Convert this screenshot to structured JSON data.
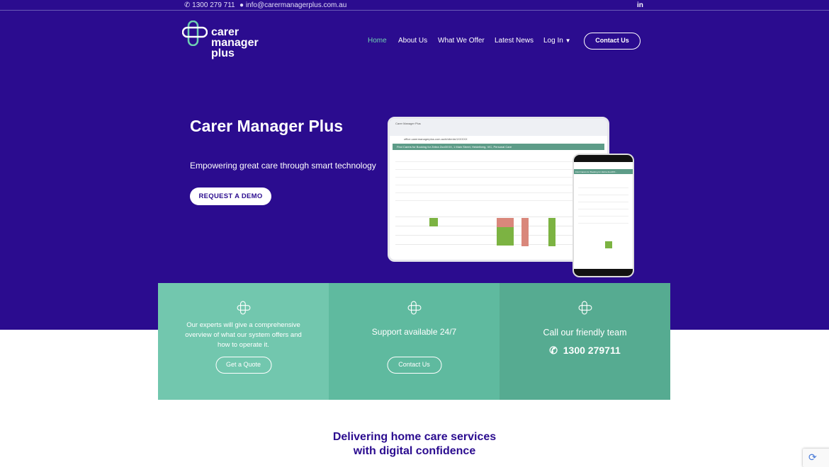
{
  "topbar": {
    "phone": "1300 279 711",
    "email": "info@carermanagerplus.com.au",
    "social": "linkedin-icon"
  },
  "logo": {
    "line1": "carer",
    "line2": "manager",
    "line3": "plus"
  },
  "nav": {
    "items": [
      {
        "label": "Home",
        "active": true
      },
      {
        "label": "About Us"
      },
      {
        "label": "What We Offer"
      },
      {
        "label": "Latest News"
      },
      {
        "label": "Log In"
      }
    ],
    "contact": "Contact Us"
  },
  "hero": {
    "title": "Carer Manager Plus",
    "subtitle": "Empowering great care through smart technology",
    "cta": "REQUEST A DEMO"
  },
  "mockup": {
    "tab_title": "Carer Manager Plus",
    "url": "office.carermanagerplus.com.au/#/clients/1XXXXX",
    "banner": "Find Carers for Booking for Zebra Zoo0XXX, 1 Main Street, Heidelberg, VIC, Personal Care",
    "phone_banner": "Find Carers for Booking for Zebra Zoo0XX..."
  },
  "cards": [
    {
      "text": "Our experts will give a comprehensive overview of what our system offers and how to operate it.",
      "button": "Get a Quote"
    },
    {
      "text": "Support available 24/7",
      "button": "Contact Us"
    },
    {
      "text": "Call our friendly team",
      "phone": "1300 279711"
    }
  ],
  "tagline": {
    "line1": "Delivering home care services",
    "line2": "with digital confidence"
  },
  "colors": {
    "brand": "#2b0c8f",
    "accent": "#6fd1b2",
    "card1": "#72c7ae",
    "card2": "#5fba9f",
    "card3": "#56ab91"
  }
}
